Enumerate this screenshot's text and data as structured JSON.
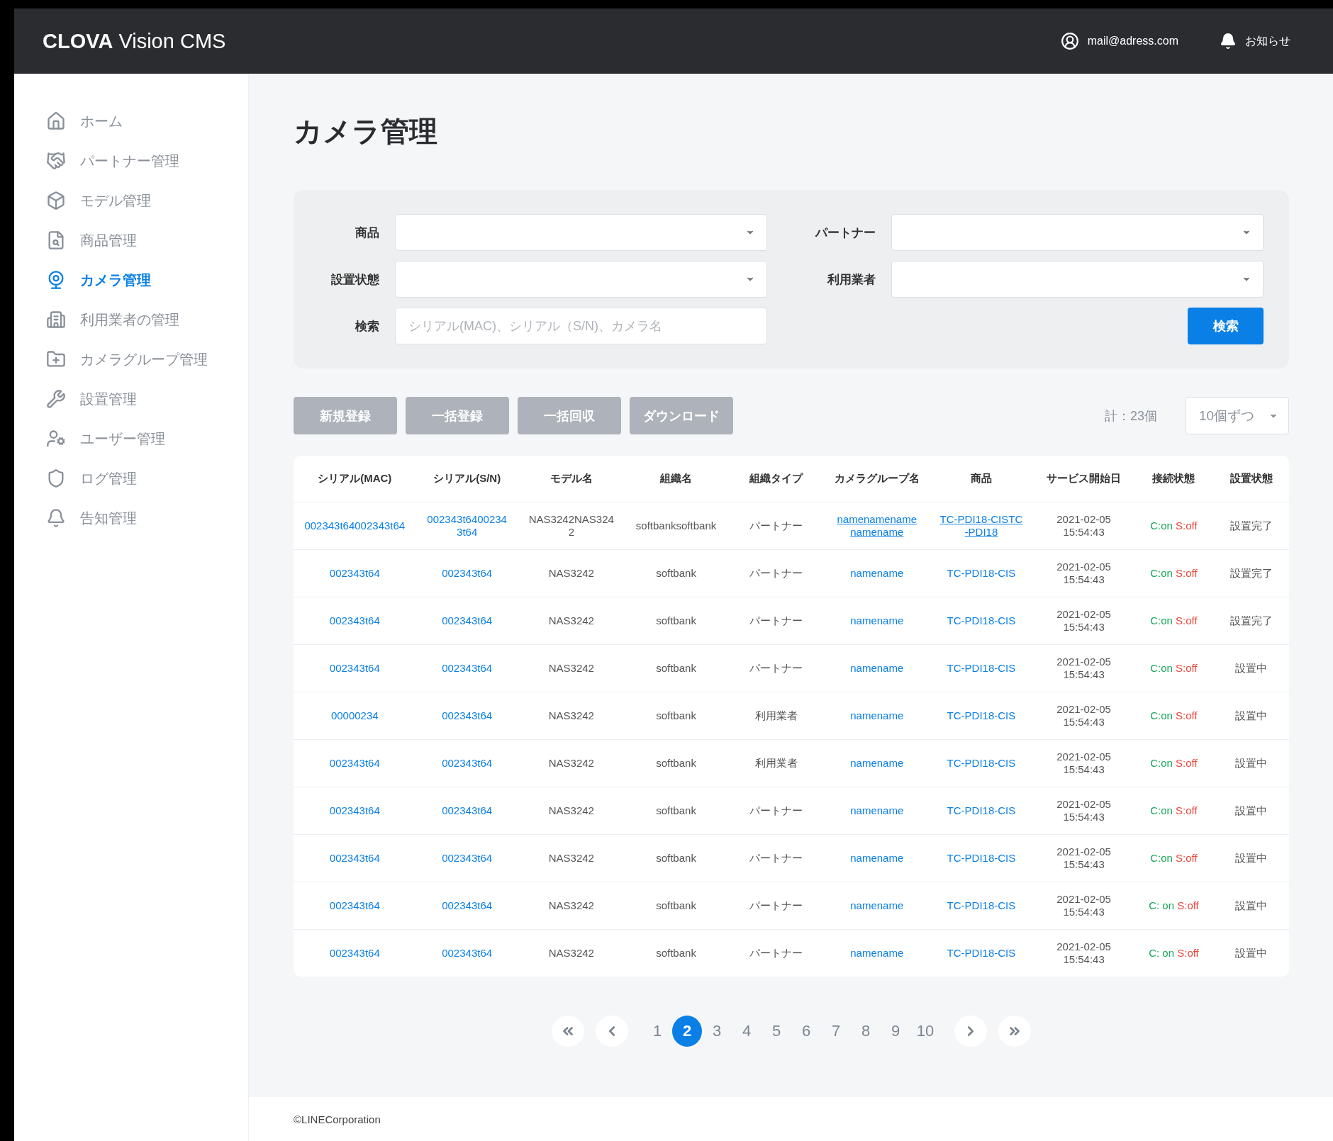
{
  "header": {
    "logo": "**CLOVA** Vision CMS",
    "user": "mail@adress.com",
    "notifications": "お知らせ"
  },
  "sidebar": {
    "items": [
      {
        "label": "ホーム",
        "selected": false
      },
      {
        "label": "パートナー管理",
        "selected": false
      },
      {
        "label": "モデル管理",
        "selected": false
      },
      {
        "label": "商品管理",
        "selected": false
      },
      {
        "label": "カメラ管理",
        "selected": true
      },
      {
        "label": "利用業者の管理",
        "selected": false
      },
      {
        "label": "カメラグループ管理",
        "selected": false
      },
      {
        "label": "設置管理",
        "selected": false
      },
      {
        "label": "ユーザー管理",
        "selected": false
      },
      {
        "label": "ログ管理",
        "selected": false
      },
      {
        "label": "告知管理",
        "selected": false
      }
    ]
  },
  "page_title": "カメラ管理",
  "filters": {
    "fields": [
      {
        "label": "商品",
        "kind": "select"
      },
      {
        "label": "パートナー",
        "kind": "select"
      },
      {
        "label": "設置状態",
        "kind": "select"
      },
      {
        "label": "利用業者",
        "kind": "select"
      },
      {
        "label": "検索",
        "kind": "text",
        "placeholder": "シリアル(MAC)、シリアル（S/N)、カメラ名"
      }
    ],
    "search_button": "検索"
  },
  "actions": [
    "新規登録",
    "一括登録",
    "一括回収",
    "ダウンロード"
  ],
  "total": "計：23個",
  "page_size": "10個ずつ",
  "table": {
    "columns": [
      "シリアル(MAC)",
      "シリアル(S/N)",
      "モデル名",
      "組織名",
      "組織タイプ",
      "カメラグループ名",
      "商品",
      "サービス開始日",
      "接続状態",
      "設置状態"
    ],
    "rows": [
      {
        "mac": "002343t64002343t64",
        "sn": "002343t64002343t64",
        "model": "NAS3242NAS3242",
        "org": "softbanksoftbank",
        "type": "パートナー",
        "group": "namenamenamenamename",
        "product": "TC-PDI18-CISTC-PDI18",
        "date": "2021-02-05 15:54:43",
        "conn_c": "C:on",
        "conn_s": "S:off",
        "install": "設置完了",
        "underlined": true
      },
      {
        "mac": "002343t64",
        "sn": "002343t64",
        "model": "NAS3242",
        "org": "softbank",
        "type": "パートナー",
        "group": "namename",
        "product": "TC-PDI18-CIS",
        "date": "2021-02-05 15:54:43",
        "conn_c": "C:on",
        "conn_s": "S:off",
        "install": "設置完了",
        "underlined": false
      },
      {
        "mac": "002343t64",
        "sn": "002343t64",
        "model": "NAS3242",
        "org": "softbank",
        "type": "パートナー",
        "group": "namename",
        "product": "TC-PDI18-CIS",
        "date": "2021-02-05 15:54:43",
        "conn_c": "C:on",
        "conn_s": "S:off",
        "install": "設置完了",
        "underlined": false
      },
      {
        "mac": "002343t64",
        "sn": "002343t64",
        "model": "NAS3242",
        "org": "softbank",
        "type": "パートナー",
        "group": "namename",
        "product": "TC-PDI18-CIS",
        "date": "2021-02-05 15:54:43",
        "conn_c": "C:on",
        "conn_s": "S:off",
        "install": "設置中",
        "underlined": false
      },
      {
        "mac": "00000234",
        "sn": "002343t64",
        "model": "NAS3242",
        "org": "softbank",
        "type": "利用業者",
        "group": "namename",
        "product": "TC-PDI18-CIS",
        "date": "2021-02-05 15:54:43",
        "conn_c": "C:on",
        "conn_s": "S:off",
        "install": "設置中",
        "underlined": false
      },
      {
        "mac": "002343t64",
        "sn": "002343t64",
        "model": "NAS3242",
        "org": "softbank",
        "type": "利用業者",
        "group": "namename",
        "product": "TC-PDI18-CIS",
        "date": "2021-02-05 15:54:43",
        "conn_c": "C:on",
        "conn_s": "S:off",
        "install": "設置中",
        "underlined": false
      },
      {
        "mac": "002343t64",
        "sn": "002343t64",
        "model": "NAS3242",
        "org": "softbank",
        "type": "パートナー",
        "group": "namename",
        "product": "TC-PDI18-CIS",
        "date": "2021-02-05 15:54:43",
        "conn_c": "C:on",
        "conn_s": "S:off",
        "install": "設置中",
        "underlined": false
      },
      {
        "mac": "002343t64",
        "sn": "002343t64",
        "model": "NAS3242",
        "org": "softbank",
        "type": "パートナー",
        "group": "namename",
        "product": "TC-PDI18-CIS",
        "date": "2021-02-05 15:54:43",
        "conn_c": "C:on",
        "conn_s": "S:off",
        "install": "設置中",
        "underlined": false
      },
      {
        "mac": "002343t64",
        "sn": "002343t64",
        "model": "NAS3242",
        "org": "softbank",
        "type": "パートナー",
        "group": "namename",
        "product": "TC-PDI18-CIS",
        "date": "2021-02-05 15:54:43",
        "conn_c": "C: on",
        "conn_s": "S:off",
        "install": "設置中",
        "underlined": false
      },
      {
        "mac": "002343t64",
        "sn": "002343t64",
        "model": "NAS3242",
        "org": "softbank",
        "type": "パートナー",
        "group": "namename",
        "product": "TC-PDI18-CIS",
        "date": "2021-02-05 15:54:43",
        "conn_c": "C: on",
        "conn_s": "S:off",
        "install": "設置中",
        "underlined": false
      }
    ]
  },
  "pagination": {
    "pages": [
      {
        "label": "1",
        "selected": false
      },
      {
        "label": "2",
        "selected": true
      },
      {
        "label": "3",
        "selected": false
      },
      {
        "label": "4",
        "selected": false
      },
      {
        "label": "5",
        "selected": false
      },
      {
        "label": "6",
        "selected": false
      },
      {
        "label": "7",
        "selected": false
      },
      {
        "label": "8",
        "selected": false
      },
      {
        "label": "9",
        "selected": false
      },
      {
        "label": "10",
        "selected": false
      }
    ]
  },
  "footer": "©LINECorporation"
}
